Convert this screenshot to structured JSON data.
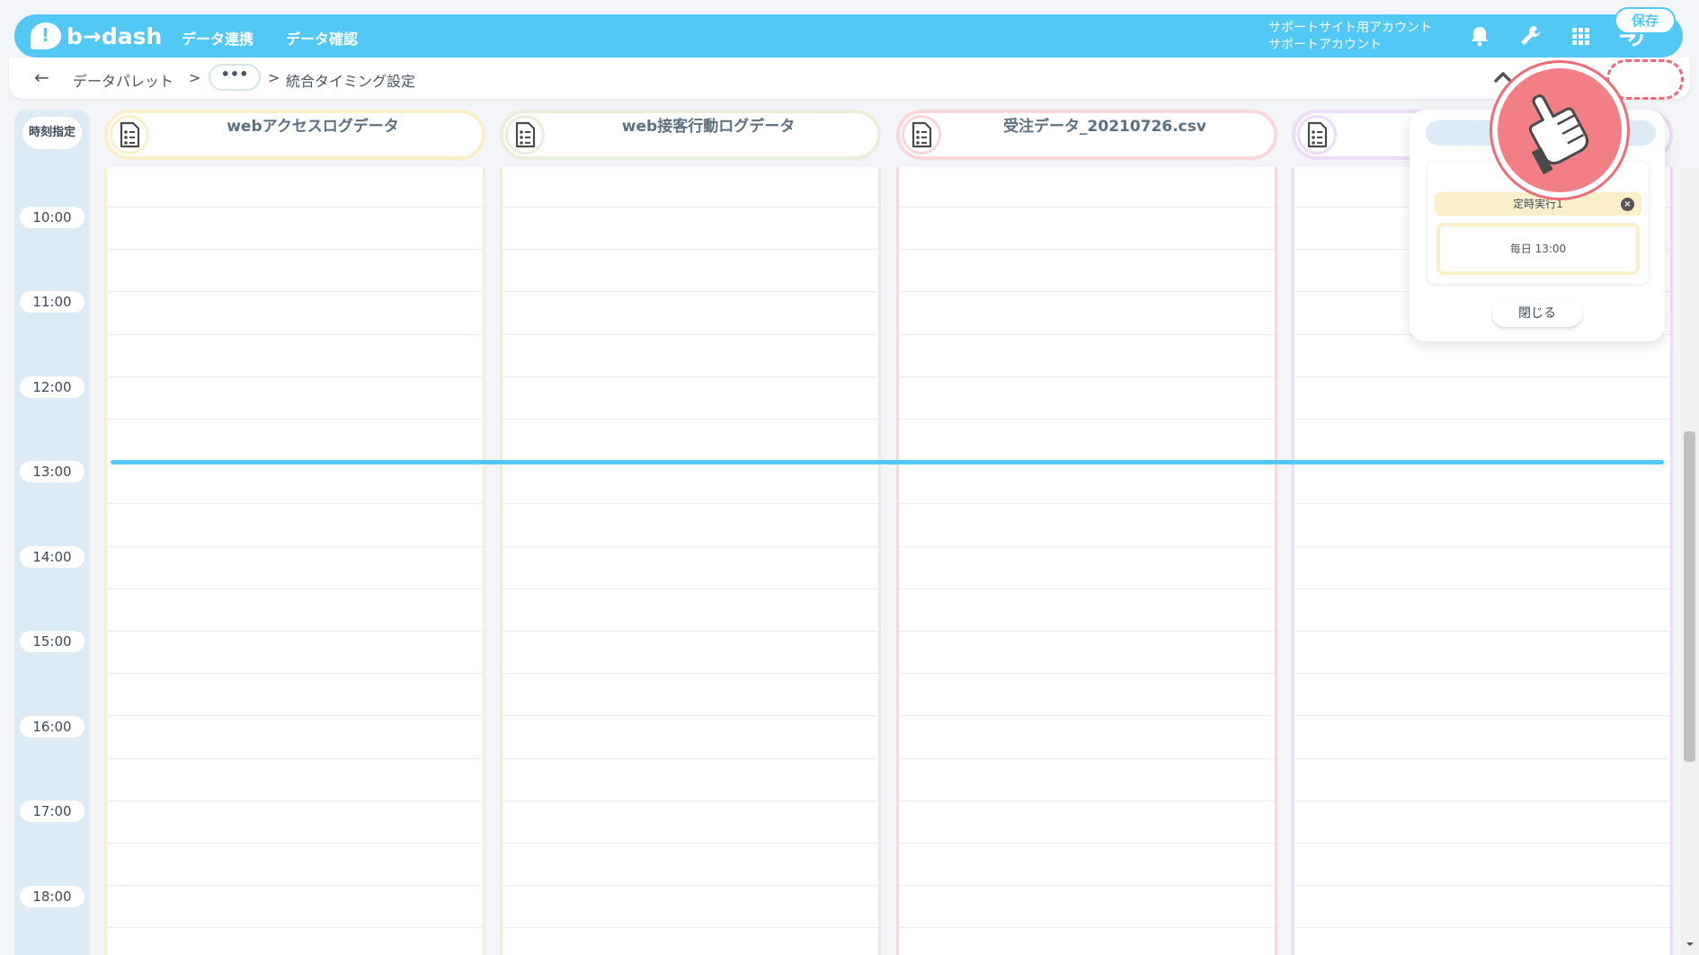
{
  "header": {
    "logo_text": "b→dash",
    "nav": [
      "データ連携",
      "データ確認"
    ],
    "account_line1": "サポートサイト用アカウント",
    "account_line2": "サポートアカウント",
    "icons": [
      "bell-icon",
      "wrench-icon",
      "grid-icon",
      "logout-icon"
    ]
  },
  "breadcrumb": {
    "back_icon": "←",
    "root": "データパレット",
    "separator": ">",
    "more": "•••",
    "current": "統合タイミング設定"
  },
  "toolbar": {
    "save_label": "保存",
    "collapse_icon": "chevron-up-icon"
  },
  "time_column": {
    "header": "時刻指定",
    "times": [
      "10:00",
      "11:00",
      "12:00",
      "13:00",
      "14:00",
      "15:00",
      "16:00",
      "17:00",
      "18:00"
    ]
  },
  "columns": [
    {
      "title": "webアクセスログデータ",
      "color": "#fbefc9"
    },
    {
      "title": "web接客行動ログデータ",
      "color": "#e8efd8"
    },
    {
      "title": "受注データ_20210726.csv",
      "color": "#fbd7da"
    },
    {
      "title": "",
      "color": "#ecdcf7"
    }
  ],
  "current_time_line": {
    "color": "#52c8f5"
  },
  "popover": {
    "schedule_name": "定時実行1",
    "schedule_time": "毎日 13:00",
    "close_label": "閉じる"
  },
  "colors": {
    "brand": "#52c8f5",
    "highlight": "#f06b78"
  }
}
